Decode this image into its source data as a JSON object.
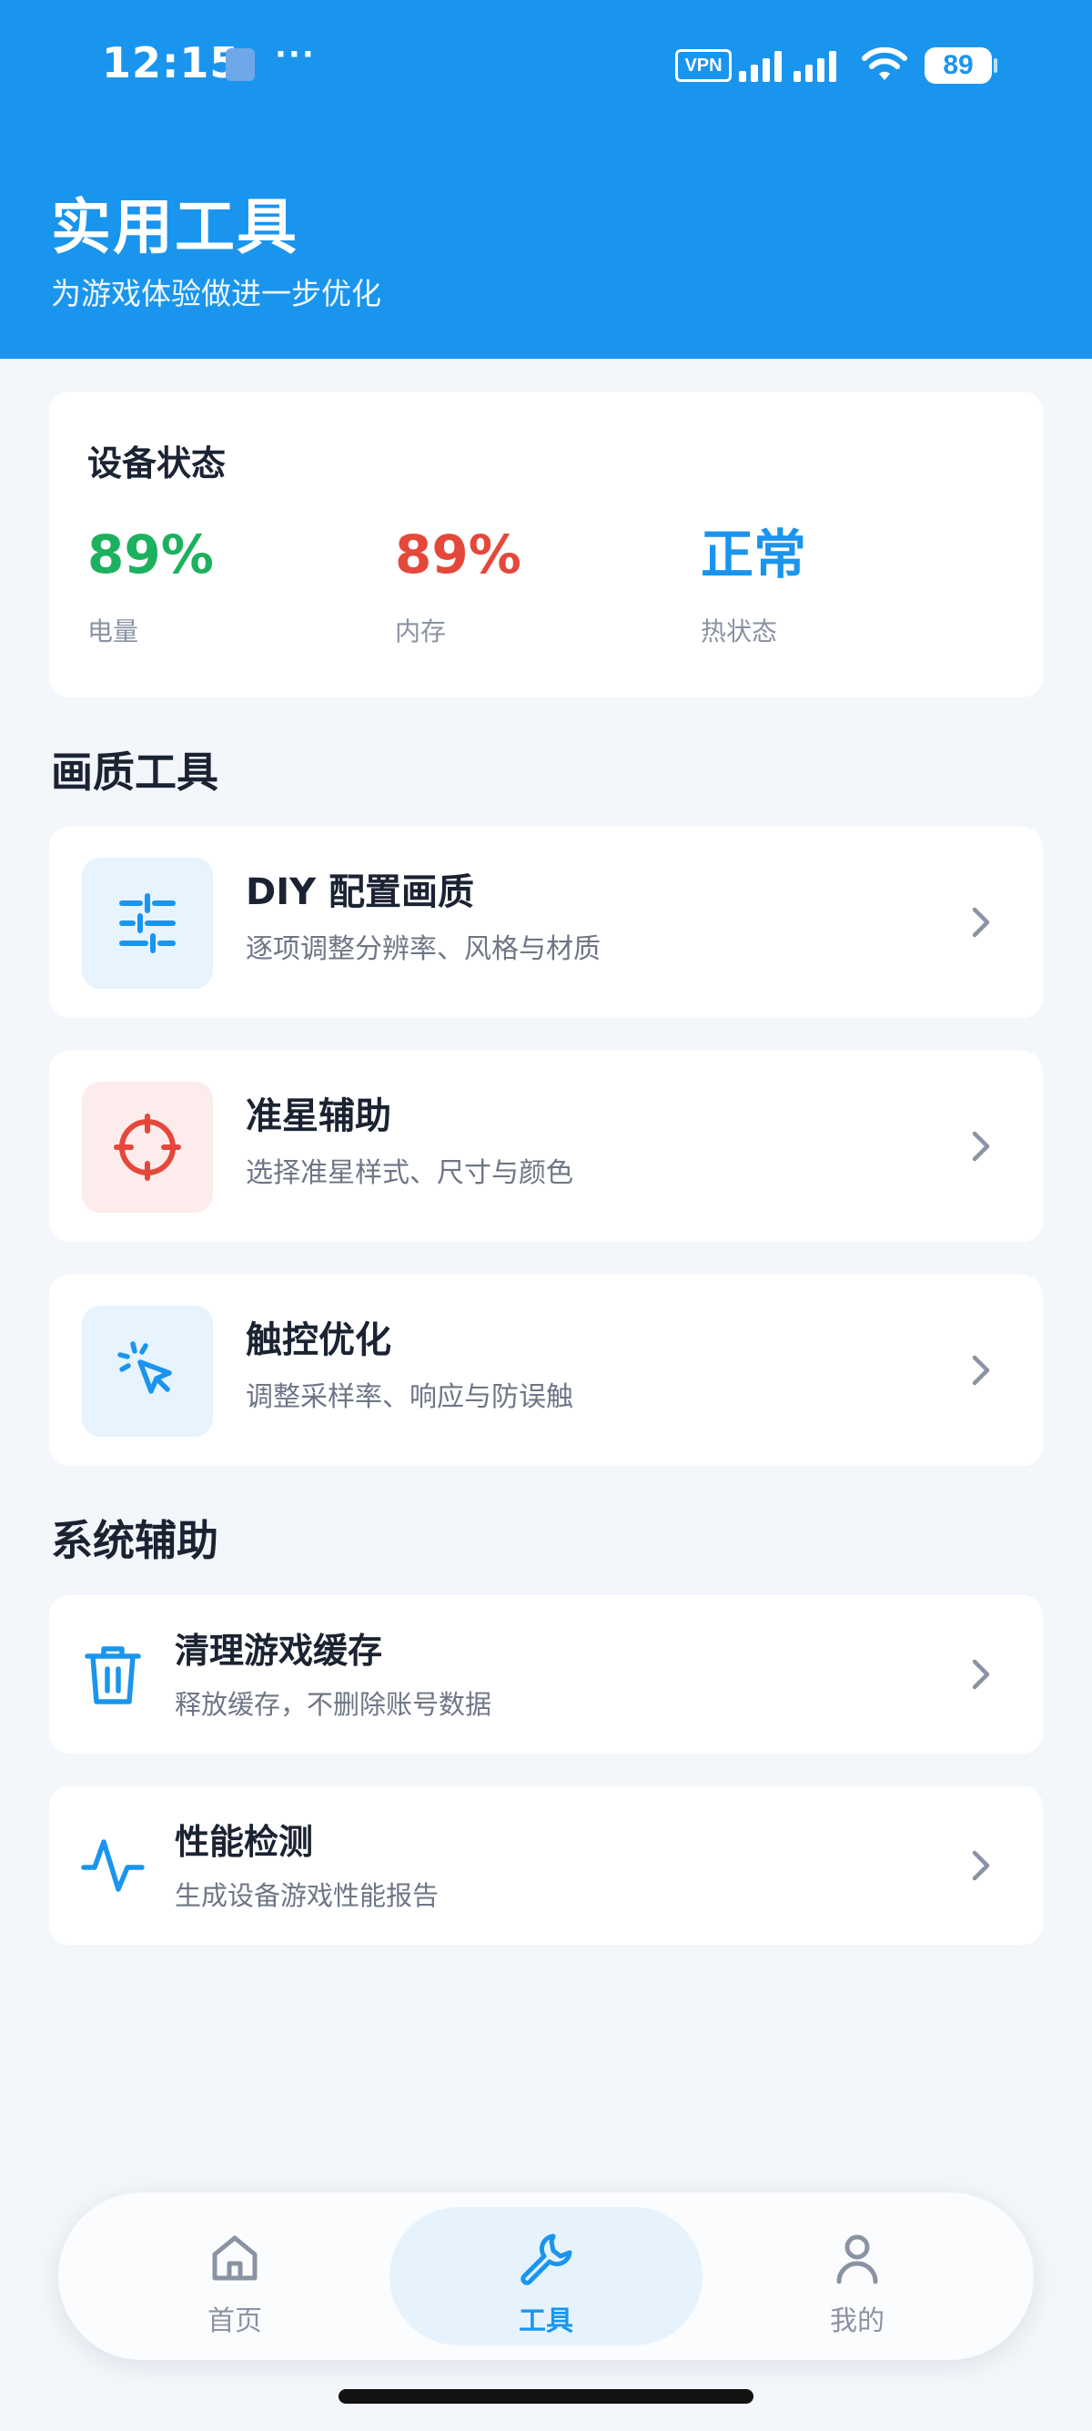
{
  "status_bar": {
    "time": "12:15",
    "dots": "···",
    "vpn": "VPN",
    "battery": "89"
  },
  "header": {
    "title": "实用工具",
    "subtitle": "为游戏体验做进一步优化"
  },
  "device_status": {
    "title": "设备状态",
    "stats": [
      {
        "value": "89%",
        "label": "电量",
        "color": "#1CB15E"
      },
      {
        "value": "89%",
        "label": "内存",
        "color": "#E5483B"
      },
      {
        "value": "正常",
        "label": "热状态",
        "color": "#1A95EE"
      }
    ]
  },
  "graphics_tools": {
    "section_title": "画质工具",
    "items": [
      {
        "title": "DIY 配置画质",
        "desc": "逐项调整分辨率、风格与材质",
        "icon": "sliders-icon",
        "tint": "#E7F3FD",
        "color": "#1A95EE"
      },
      {
        "title": "准星辅助",
        "desc": "选择准星样式、尺寸与颜色",
        "icon": "crosshair-icon",
        "tint": "#FDECEC",
        "color": "#E5483B"
      },
      {
        "title": "触控优化",
        "desc": "调整采样率、响应与防误触",
        "icon": "touch-pointer-icon",
        "tint": "#E7F3FD",
        "color": "#1A95EE"
      }
    ]
  },
  "system_tools": {
    "section_title": "系统辅助",
    "items": [
      {
        "title": "清理游戏缓存",
        "desc": "释放缓存，不删除账号数据",
        "icon": "trash-icon"
      },
      {
        "title": "性能检测",
        "desc": "生成设备游戏性能报告",
        "icon": "pulse-icon"
      }
    ]
  },
  "bottom_nav": {
    "items": [
      {
        "label": "首页",
        "icon": "home-icon",
        "active": false
      },
      {
        "label": "工具",
        "icon": "wrench-icon",
        "active": true
      },
      {
        "label": "我的",
        "icon": "user-icon",
        "active": false
      }
    ]
  },
  "colors": {
    "primary": "#1A95EE",
    "background": "#F3F6FA",
    "success": "#1CB15E",
    "danger": "#E5483B"
  }
}
